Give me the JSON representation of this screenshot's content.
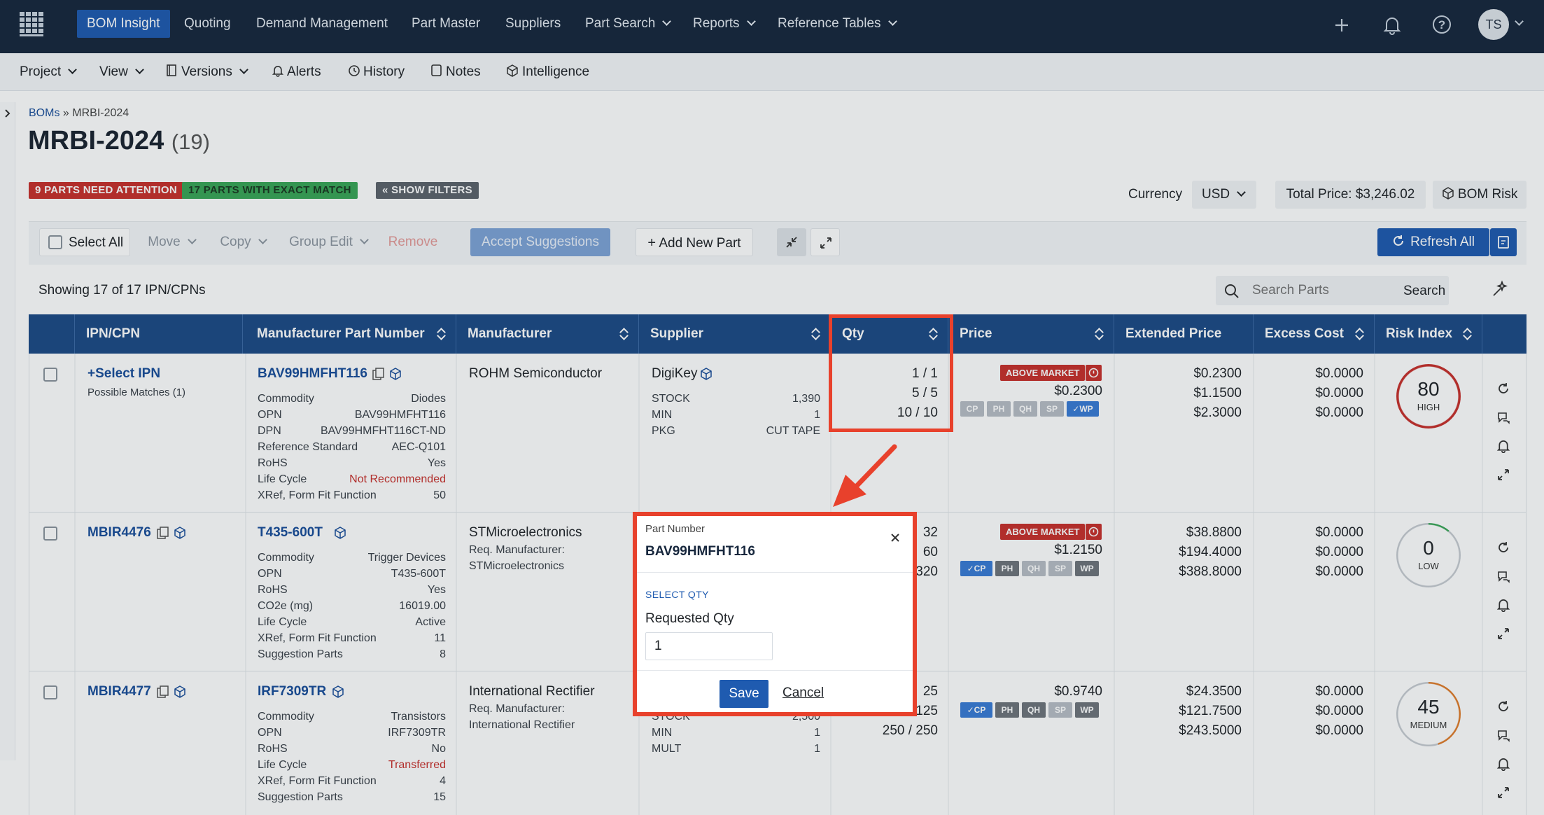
{
  "topnav": {
    "items": [
      "BOM Insight",
      "Quoting",
      "Demand Management",
      "Part Master",
      "Suppliers",
      "Part Search",
      "Reports",
      "Reference Tables"
    ],
    "avatar": "TS"
  },
  "subnav": {
    "items": [
      "Project",
      "View",
      "Versions",
      "Alerts",
      "History",
      "Notes",
      "Intelligence"
    ]
  },
  "breadcrumb": {
    "root": "BOMs",
    "sep": "»",
    "current": "MRBI-2024"
  },
  "page": {
    "title": "MRBI-2024",
    "count": "(19)"
  },
  "badges": {
    "attention": "9 PARTS NEED ATTENTION",
    "exact": "17 PARTS WITH EXACT MATCH",
    "filters": "« SHOW FILTERS"
  },
  "summary": {
    "currency_label": "Currency",
    "currency": "USD",
    "total": "Total Price: $3,246.02",
    "risk": "BOM Risk"
  },
  "toolbar": {
    "select_all": "Select All",
    "move": "Move",
    "copy": "Copy",
    "group_edit": "Group Edit",
    "remove": "Remove",
    "accept": "Accept Suggestions",
    "add_part": "Add New Part",
    "refresh": "Refresh All"
  },
  "showing": "Showing 17 of 17 IPN/CPNs",
  "search": {
    "placeholder": "Search Parts",
    "button": "Search"
  },
  "columns": [
    "IPN/CPN",
    "Manufacturer Part Number",
    "Manufacturer",
    "Supplier",
    "Qty",
    "Price",
    "Extended Price",
    "Excess Cost",
    "Risk Index"
  ],
  "rows": [
    {
      "ipn": "Select IPN",
      "ipn_note": "Possible Matches (1)",
      "mpn": "BAV99HMFHT116",
      "attrs": [
        [
          "Commodity",
          "Diodes"
        ],
        [
          "OPN",
          "BAV99HMFHT116"
        ],
        [
          "DPN",
          "BAV99HMFHT116CT-ND"
        ],
        [
          "Reference Standard",
          "AEC-Q101"
        ],
        [
          "RoHS",
          "Yes"
        ],
        [
          "Life Cycle",
          "Not Recommended"
        ],
        [
          "XRef, Form Fit Function",
          "50"
        ]
      ],
      "manufacturer": "ROHM Semiconductor",
      "supplier": "DigiKey",
      "supplier_attrs": [
        [
          "STOCK",
          "1,390"
        ],
        [
          "MIN",
          "1"
        ],
        [
          "PKG",
          "CUT TAPE"
        ]
      ],
      "qty": [
        "1 / 1",
        "5 / 5",
        "10 / 10"
      ],
      "market": "ABOVE MARKET",
      "price": "$0.2300",
      "chips": [
        "CP",
        "PH",
        "QH",
        "SP",
        "✓WP"
      ],
      "ext": [
        "$0.2300",
        "$1.1500",
        "$2.3000"
      ],
      "excess": [
        "$0.0000",
        "$0.0000",
        "$0.0000"
      ],
      "risk": "80",
      "risk_label": "HIGH",
      "risk_level": 0.8,
      "risk_color": "#c8302c"
    },
    {
      "ipn": "MBIR4476",
      "mpn": "T435-600T",
      "attrs": [
        [
          "Commodity",
          "Trigger Devices"
        ],
        [
          "OPN",
          "T435-600T"
        ],
        [
          "RoHS",
          "Yes"
        ],
        [
          "CO2e (mg)",
          "16019.00"
        ],
        [
          "Life Cycle",
          "Active"
        ],
        [
          "XRef, Form Fit Function",
          "11"
        ],
        [
          "Suggestion Parts",
          "8"
        ]
      ],
      "manufacturer": "STMicroelectronics",
      "req_label": "Req. Manufacturer:",
      "req_value": "STMicroelectronics",
      "qty": [
        "32",
        "60",
        "320"
      ],
      "market": "ABOVE MARKET",
      "price": "$1.2150",
      "chips": [
        "✓CP",
        "PH",
        "QH",
        "SP",
        "WP"
      ],
      "ext": [
        "$38.8800",
        "$194.4000",
        "$388.8000"
      ],
      "excess": [
        "$0.0000",
        "$0.0000",
        "$0.0000"
      ],
      "risk": "0",
      "risk_label": "LOW",
      "risk_level": 0.0,
      "risk_color": "#3aa657"
    },
    {
      "ipn": "MBIR4477",
      "mpn": "IRF7309TR",
      "attrs": [
        [
          "Commodity",
          "Transistors"
        ],
        [
          "OPN",
          "IRF7309TR"
        ],
        [
          "RoHS",
          "No"
        ],
        [
          "Life Cycle",
          "Transferred"
        ],
        [
          "XRef, Form Fit Function",
          "4"
        ],
        [
          "Suggestion Parts",
          "15"
        ]
      ],
      "manufacturer": "International Rectifier",
      "req_label": "Req. Manufacturer:",
      "req_value": "International Rectifier",
      "supplier_attrs": [
        [
          "STOCK",
          "2,500"
        ],
        [
          "MIN",
          "1"
        ],
        [
          "MULT",
          "1"
        ]
      ],
      "qty": [
        "25",
        "125",
        "250 / 250"
      ],
      "price": "$0.9740",
      "chips": [
        "✓CP",
        "PH",
        "QH",
        "SP",
        "WP"
      ],
      "ext": [
        "$24.3500",
        "$121.7500",
        "$243.5000"
      ],
      "excess": [
        "$0.0000",
        "$0.0000",
        "$0.0000"
      ],
      "risk": "45",
      "risk_label": "MEDIUM",
      "risk_level": 0.45,
      "risk_color": "#e07b2a"
    }
  ],
  "modal": {
    "label": "Part Number",
    "part": "BAV99HMFHT116",
    "section": "SELECT QTY",
    "field_label": "Requested Qty",
    "field_value": "1",
    "save": "Save",
    "cancel": "Cancel"
  },
  "colors": {
    "nav": "#17273d",
    "accent": "#1f5bb0",
    "header": "#1d4a86",
    "highlight": "#e8412c",
    "danger": "#c8302c",
    "success": "#3aa657"
  }
}
